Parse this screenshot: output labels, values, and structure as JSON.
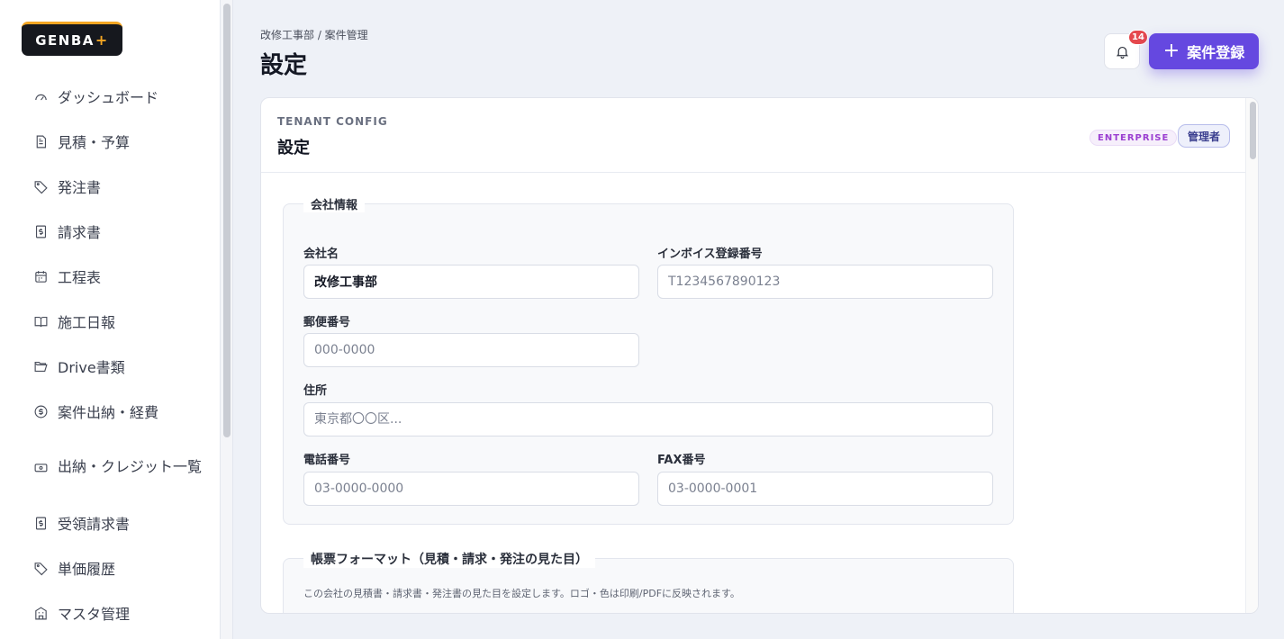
{
  "logo": {
    "text": "GENBA",
    "plus": "+"
  },
  "sidebar": {
    "items": [
      {
        "label": "ダッシュボード",
        "icon": "gauge-icon"
      },
      {
        "label": "見積・予算",
        "icon": "document-icon"
      },
      {
        "label": "発注書",
        "icon": "tag-icon"
      },
      {
        "label": "請求書",
        "icon": "invoice-icon"
      },
      {
        "label": "工程表",
        "icon": "calendar-icon"
      },
      {
        "label": "施工日報",
        "icon": "book-icon"
      },
      {
        "label": "Drive書類",
        "icon": "folder-icon"
      },
      {
        "label": "案件出納・経費",
        "icon": "dollar-circle-icon"
      },
      {
        "label": "出納・クレジット一覧",
        "icon": "card-icon"
      },
      {
        "label": "受領請求書",
        "icon": "invoice-icon"
      },
      {
        "label": "単価履歴",
        "icon": "tag-icon"
      },
      {
        "label": "マスタ管理",
        "icon": "building-icon"
      }
    ]
  },
  "header": {
    "breadcrumb": "改修工事部 / 案件管理",
    "title": "設定",
    "notification_count": "14",
    "primary_button": "案件登録"
  },
  "card": {
    "eyebrow": "TENANT CONFIG",
    "title": "設定",
    "plan_badge": "ENTERPRISE",
    "role_badge": "管理者"
  },
  "company": {
    "legend": "会社情報",
    "name_label": "会社名",
    "name_value": "改修工事部",
    "invoice_label": "インボイス登録番号",
    "invoice_placeholder": "T1234567890123",
    "postal_label": "郵便番号",
    "postal_placeholder": "000-0000",
    "address_label": "住所",
    "address_placeholder": "東京都〇〇区...",
    "phone_label": "電話番号",
    "phone_placeholder": "03-0000-0000",
    "fax_label": "FAX番号",
    "fax_placeholder": "03-0000-0001"
  },
  "format": {
    "legend": "帳票フォーマット（見積・請求・発注の見た目）",
    "description": "この会社の見積書・請求書・発注書の見た目を設定します。ロゴ・色は印刷/PDFに反映されます。"
  },
  "colors": {
    "accent": "#6548e0",
    "logo_accent": "#f5a623",
    "badge": "#e5484d"
  }
}
